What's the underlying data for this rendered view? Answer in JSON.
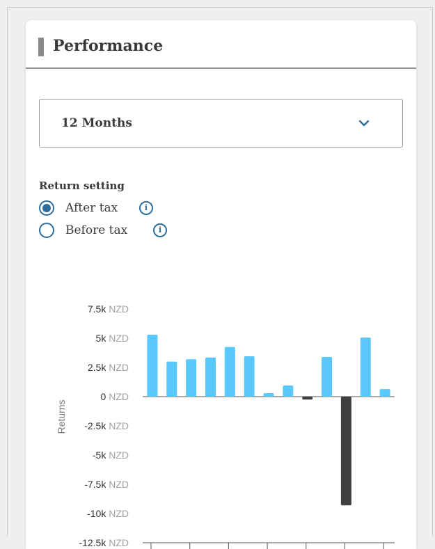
{
  "card": {
    "title": "Performance"
  },
  "period_select": {
    "value": "12 Months",
    "icon": "chevron-down-icon"
  },
  "return_setting": {
    "label": "Return setting",
    "options": [
      {
        "label": "After tax",
        "selected": true,
        "icon": "info-icon",
        "icon_glyph": "i"
      },
      {
        "label": "Before tax",
        "selected": false,
        "icon": "info-icon",
        "icon_glyph": "i"
      }
    ]
  },
  "colors": {
    "accent": "#2d6d9e",
    "positive_bar": "#5ac8fa",
    "negative_bar": "#3f3f3f",
    "axis_text": "#333333",
    "unit_text": "#a0a0a0"
  },
  "chart_data": {
    "type": "bar",
    "ylabel": "Returns",
    "unit": "NZD",
    "ylim": [
      -12500,
      7500
    ],
    "yticks": [
      {
        "value": 7500,
        "label": "7.5k"
      },
      {
        "value": 5000,
        "label": "5k"
      },
      {
        "value": 2500,
        "label": "2.5k"
      },
      {
        "value": 0,
        "label": "0"
      },
      {
        "value": -2500,
        "label": "-2.5k"
      },
      {
        "value": -5000,
        "label": "-5k"
      },
      {
        "value": -7500,
        "label": "-7.5k"
      },
      {
        "value": -10000,
        "label": "-10k"
      },
      {
        "value": -12500,
        "label": "-12.5k"
      }
    ],
    "values": [
      5300,
      3000,
      3200,
      3350,
      4250,
      3450,
      300,
      950,
      -250,
      3400,
      -9300,
      5050,
      650
    ]
  }
}
